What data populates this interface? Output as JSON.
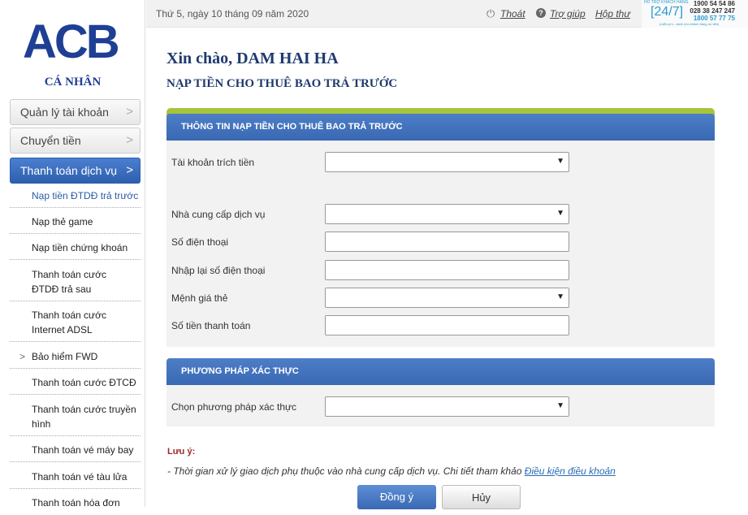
{
  "brand": {
    "logo": "ACB",
    "segment": "CÁ NHÂN"
  },
  "sidebar": {
    "menus": [
      {
        "label": "Quản lý tài khoản"
      },
      {
        "label": "Chuyển tiền"
      },
      {
        "label": "Thanh toán dịch vụ"
      }
    ],
    "items": [
      "Nạp tiền ĐTDĐ trả trước",
      "Nạp thẻ game",
      "Nạp tiền chứng khoán",
      "Thanh toán cước ĐTDĐ trả sau",
      "Thanh toán cước Internet ADSL",
      "Bảo hiểm FWD",
      "Thanh toán cước ĐTCĐ",
      "Thanh toán cước truyền hình",
      "Thanh toán vé máy bay",
      "Thanh toán vé tàu lửa",
      "Thanh toán hóa đơn"
    ]
  },
  "topbar": {
    "date": "Thứ 5, ngày 10 tháng 09 năm 2020",
    "logout": "Thoát",
    "help": "Trợ giúp",
    "inbox": "Hộp thư"
  },
  "hotline": {
    "label": "HỖ TRỢ KHÁCH HÀNG",
    "badge": "[24/7]",
    "phones": [
      "1900 54 54 86",
      "028 38 247 247",
      "1800 57 77 75"
    ],
    "sub": "(miễn phí - dành cho khách hàng ưu tiên)"
  },
  "main": {
    "greeting": "Xin chào, DAM HAI HA",
    "title": "NẠP TIỀN CHO THUÊ BAO TRẢ TRƯỚC",
    "section1": {
      "header": "THÔNG TIN NẠP TIỀN CHO THUÊ BAO TRẢ TRƯỚC",
      "fields": [
        "Tài khoản trích tiền",
        "Nhà cung cấp dịch vụ",
        "Số điện thoại",
        "Nhập lại số điện thoại",
        "Mệnh giá thẻ",
        "Số tiền thanh toán"
      ]
    },
    "section2": {
      "header": "PHƯƠNG PHÁP XÁC THỰC",
      "field": "Chọn phương pháp xác thực"
    },
    "note_title": "Lưu ý:",
    "note_text": "- Thời gian xử lý giao dịch phụ thuộc vào nhà cung cấp dịch vụ. Chi tiết tham khảo ",
    "note_link": "Điều kiện điều khoản",
    "ok": "Đồng ý",
    "cancel": "Hủy"
  },
  "colors": {
    "brand": "#1e3f94",
    "accent": "#3a68b3",
    "panel_top": "#a8c43a"
  }
}
